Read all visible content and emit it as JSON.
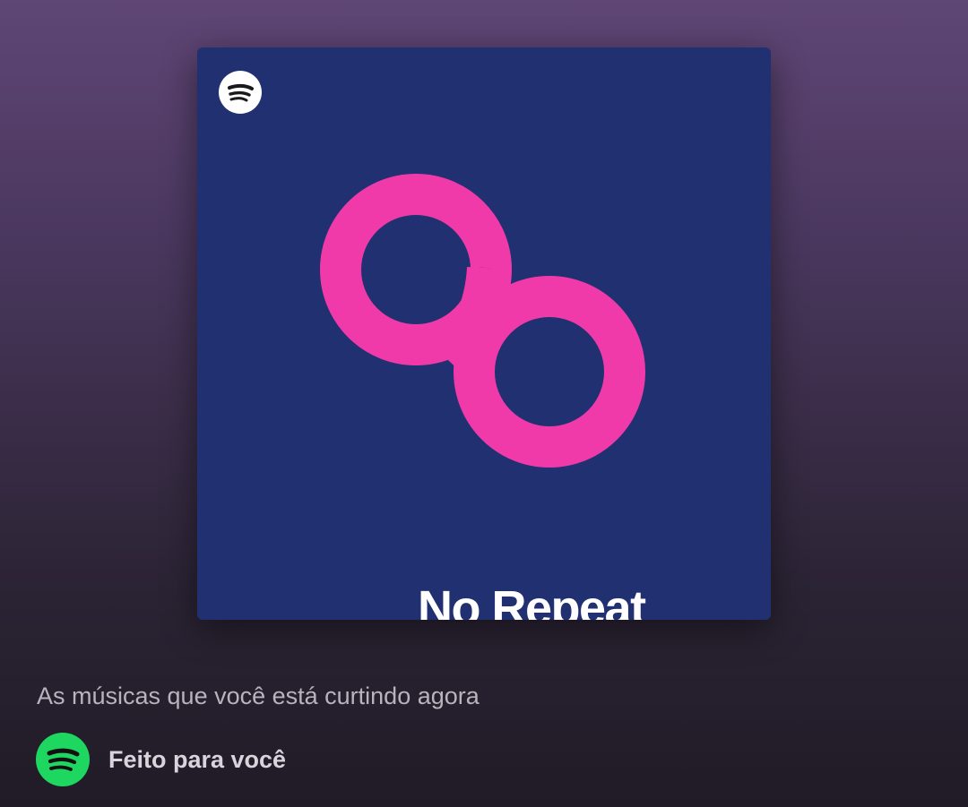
{
  "playlist": {
    "cover": {
      "title": "No Repeat",
      "background_color": "#203070",
      "art_color": "#f03aaa",
      "logo_icon": "spotify-logo-icon"
    },
    "description": "As músicas que você está curtindo agora",
    "owner": {
      "label": "Feito para você",
      "icon": "spotify-logo-icon",
      "icon_color": "#1ed760"
    }
  },
  "colors": {
    "page_gradient_top": "#5f4675",
    "page_gradient_bottom": "#211b27"
  }
}
